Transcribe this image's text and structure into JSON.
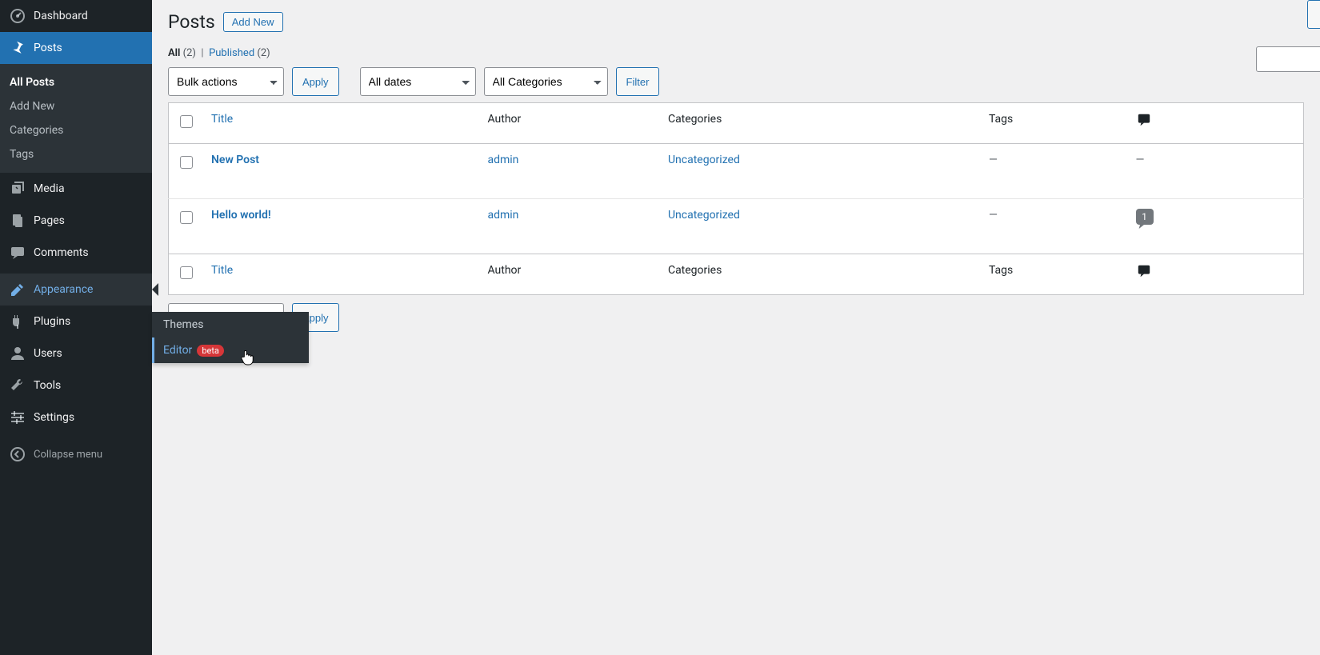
{
  "sidebar": {
    "dashboard": "Dashboard",
    "posts": "Posts",
    "posts_sub": {
      "all": "All Posts",
      "add": "Add New",
      "cats": "Categories",
      "tags": "Tags"
    },
    "media": "Media",
    "pages": "Pages",
    "comments": "Comments",
    "appearance": "Appearance",
    "plugins": "Plugins",
    "users": "Users",
    "tools": "Tools",
    "settings": "Settings",
    "collapse": "Collapse menu"
  },
  "flyout": {
    "themes": "Themes",
    "editor": "Editor",
    "beta": "beta"
  },
  "header": {
    "title": "Posts",
    "add_new": "Add New"
  },
  "filters_row": {
    "all": "All",
    "all_count": "(2)",
    "published": "Published",
    "published_count": "(2)"
  },
  "actions": {
    "bulk": "Bulk actions",
    "apply": "Apply",
    "all_dates": "All dates",
    "all_cats": "All Categories",
    "filter": "Filter"
  },
  "table": {
    "cols": {
      "title": "Title",
      "author": "Author",
      "categories": "Categories",
      "tags": "Tags"
    },
    "rows": [
      {
        "title": "New Post",
        "author": "admin",
        "category": "Uncategorized",
        "tags": "—",
        "comments": 0
      },
      {
        "title": "Hello world!",
        "author": "admin",
        "category": "Uncategorized",
        "tags": "—",
        "comments": 1
      }
    ]
  }
}
